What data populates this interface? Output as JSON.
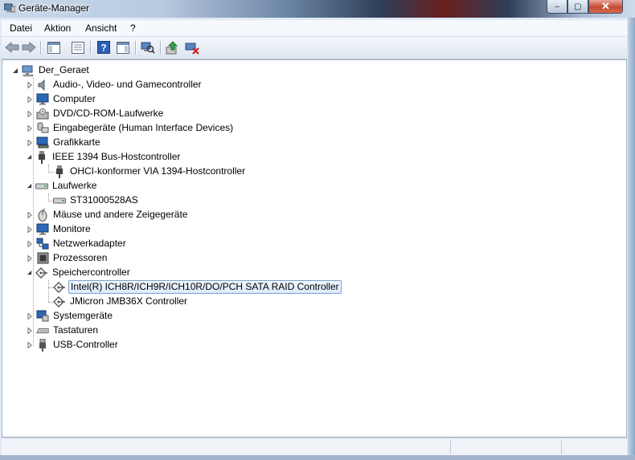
{
  "window": {
    "title": "Geräte-Manager",
    "close_glyph": "✕",
    "max_glyph": "▢",
    "min_glyph": "–"
  },
  "menu": {
    "items": [
      "Datei",
      "Aktion",
      "Ansicht",
      "?"
    ]
  },
  "toolbar": {
    "buttons": [
      "back-arrow-icon",
      "forward-arrow-icon",
      "show-hide-console-tree-icon",
      "properties-icon",
      "help-icon",
      "action-pane-icon",
      "scan-hardware-icon",
      "update-driver-icon",
      "uninstall-icon"
    ]
  },
  "tree": {
    "root": {
      "label": "Der_Geraet",
      "icon": "computer-icon"
    },
    "nodes": [
      {
        "label": "Audio-, Video- und Gamecontroller",
        "icon": "speaker-icon",
        "expanded": false
      },
      {
        "label": "Computer",
        "icon": "monitor-icon",
        "expanded": false
      },
      {
        "label": "DVD/CD-ROM-Laufwerke",
        "icon": "dvd-drive-icon",
        "expanded": false
      },
      {
        "label": "Eingabegeräte (Human Interface Devices)",
        "icon": "hid-icon",
        "expanded": false
      },
      {
        "label": "Grafikkarte",
        "icon": "display-adapter-icon",
        "expanded": false
      },
      {
        "label": "IEEE 1394 Bus-Hostcontroller",
        "icon": "firewire-icon",
        "expanded": true,
        "children": [
          {
            "label": "OHCI-konformer VIA 1394-Hostcontroller",
            "icon": "firewire-icon"
          }
        ]
      },
      {
        "label": "Laufwerke",
        "icon": "disk-drive-icon",
        "expanded": true,
        "children": [
          {
            "label": "ST31000528AS",
            "icon": "disk-drive-icon"
          }
        ]
      },
      {
        "label": "Mäuse und andere Zeigegeräte",
        "icon": "mouse-icon",
        "expanded": false
      },
      {
        "label": "Monitore",
        "icon": "monitor-icon",
        "expanded": false
      },
      {
        "label": "Netzwerkadapter",
        "icon": "network-adapter-icon",
        "expanded": false
      },
      {
        "label": "Prozessoren",
        "icon": "processor-icon",
        "expanded": false
      },
      {
        "label": "Speichercontroller",
        "icon": "storage-controller-icon",
        "expanded": true,
        "children": [
          {
            "label": "Intel(R) ICH8R/ICH9R/ICH10R/DO/PCH SATA RAID Controller",
            "icon": "storage-controller-icon",
            "selected": true
          },
          {
            "label": "JMicron JMB36X Controller",
            "icon": "storage-controller-icon"
          }
        ]
      },
      {
        "label": "Systemgeräte",
        "icon": "system-device-icon",
        "expanded": false
      },
      {
        "label": "Tastaturen",
        "icon": "keyboard-icon",
        "expanded": false
      },
      {
        "label": "USB-Controller",
        "icon": "usb-icon",
        "expanded": false
      }
    ]
  },
  "colors": {
    "selection_border": "#7da2ce",
    "selection_fill": "#dbeafb",
    "window_frame": "#dfe9f5"
  }
}
